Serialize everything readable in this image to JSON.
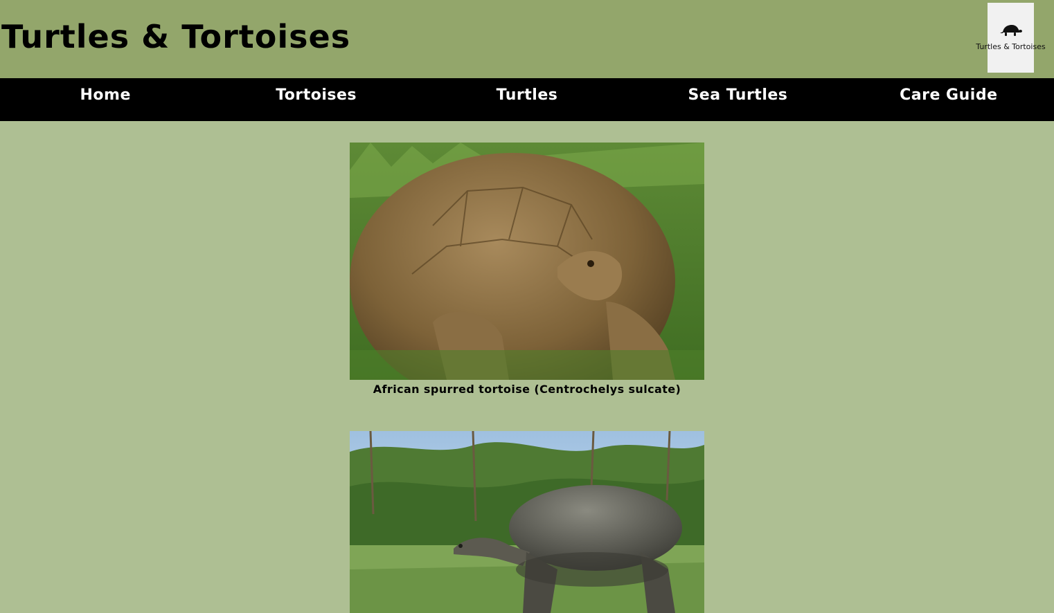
{
  "header": {
    "title": "Turtles & Tortoises",
    "logo_text": "Turtles & Tortoises",
    "logo_icon": "turtle-icon"
  },
  "nav": {
    "items": [
      "Home",
      "Tortoises",
      "Turtles",
      "Sea Turtles",
      "Care Guide"
    ]
  },
  "gallery": [
    {
      "caption": "African spurred tortoise (Centrochelys sulcate)",
      "image": "sulcata-tortoise-photo"
    },
    {
      "caption": "",
      "image": "giant-tortoise-photo"
    }
  ],
  "colors": {
    "header_bg": "#93a66b",
    "page_bg": "#aebf93",
    "nav_bg": "#000000",
    "nav_text": "#ffffff"
  }
}
